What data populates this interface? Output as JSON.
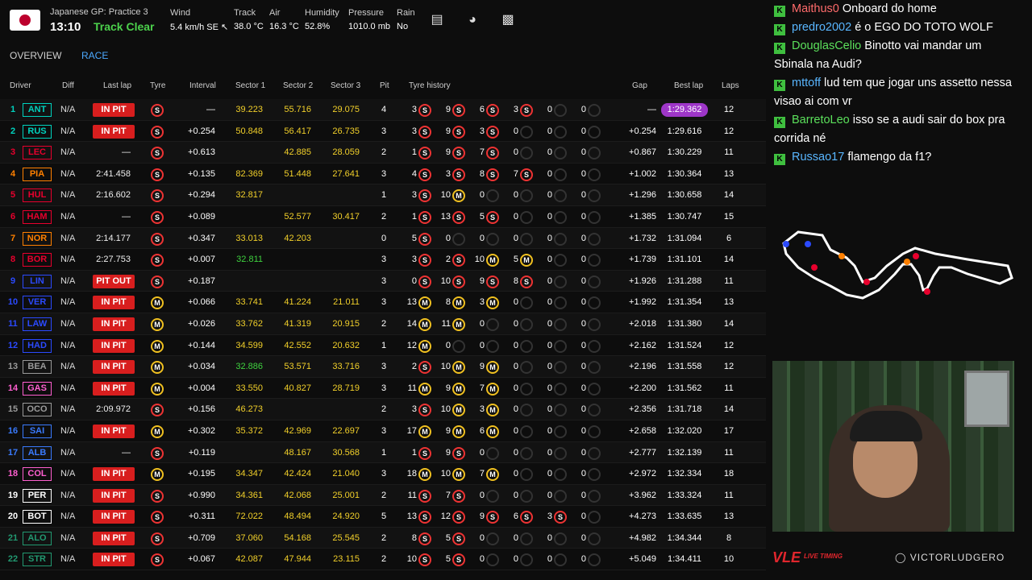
{
  "header": {
    "session": "Japanese GP: Practice 3",
    "time": "13:10",
    "status": "Track Clear",
    "weather": [
      {
        "label": "Wind",
        "value": "5.4 km/h SE ↖"
      },
      {
        "label": "Track",
        "value": "38.0 °C"
      },
      {
        "label": "Air",
        "value": "16.3 °C"
      },
      {
        "label": "Humidity",
        "value": "52.8%"
      },
      {
        "label": "Pressure",
        "value": "1010.0 mb"
      },
      {
        "label": "Rain",
        "value": "No"
      }
    ]
  },
  "tabs": [
    "OVERVIEW",
    "RACE"
  ],
  "columns": [
    "Driver",
    "Diff",
    "Last lap",
    "Tyre",
    "Interval",
    "Sector 1",
    "Sector 2",
    "Sector 3",
    "Pit",
    "Tyre history",
    "Gap",
    "Best lap",
    "Laps"
  ],
  "rows": [
    {
      "pos": "1",
      "abbr": "ANT",
      "color": "#00d2be",
      "diff": "N/A",
      "last": "IN PIT",
      "tyre": "S",
      "interval": "—",
      "s1": "39.223",
      "s1c": "yellow",
      "s2": "55.716",
      "s2c": "yellow",
      "s3": "29.075",
      "s3c": "yellow",
      "pit": "4",
      "hist": [
        [
          "3",
          "S"
        ],
        [
          "9",
          "S"
        ],
        [
          "6",
          "S"
        ],
        [
          "3",
          "S"
        ],
        [
          "0",
          ""
        ],
        [
          "0",
          ""
        ]
      ],
      "gap": "—",
      "best": "1:29.362",
      "purple": true,
      "laps": "12"
    },
    {
      "pos": "2",
      "abbr": "RUS",
      "color": "#00d2be",
      "diff": "N/A",
      "last": "IN PIT",
      "tyre": "S",
      "interval": "+0.254",
      "s1": "50.848",
      "s1c": "yellow",
      "s2": "56.417",
      "s2c": "yellow",
      "s3": "26.735",
      "s3c": "yellow",
      "pit": "3",
      "hist": [
        [
          "3",
          "S"
        ],
        [
          "9",
          "S"
        ],
        [
          "3",
          "S"
        ],
        [
          "0",
          ""
        ],
        [
          "0",
          ""
        ],
        [
          "0",
          ""
        ]
      ],
      "gap": "+0.254",
      "best": "1:29.616",
      "laps": "12"
    },
    {
      "pos": "3",
      "abbr": "LEC",
      "color": "#e8002d",
      "diff": "N/A",
      "last": "—",
      "tyre": "S",
      "interval": "+0.613",
      "s1": "",
      "s2": "42.885",
      "s2c": "yellow",
      "s3": "28.059",
      "s3c": "yellow",
      "pit": "2",
      "hist": [
        [
          "1",
          "S"
        ],
        [
          "9",
          "S"
        ],
        [
          "7",
          "S"
        ],
        [
          "0",
          ""
        ],
        [
          "0",
          ""
        ],
        [
          "0",
          ""
        ]
      ],
      "gap": "+0.867",
      "best": "1:30.229",
      "laps": "11"
    },
    {
      "pos": "4",
      "abbr": "PIA",
      "color": "#ff8000",
      "diff": "N/A",
      "last": "2:41.458",
      "tyre": "S",
      "interval": "+0.135",
      "s1": "82.369",
      "s1c": "yellow",
      "s2": "51.448",
      "s2c": "yellow",
      "s3": "27.641",
      "s3c": "yellow",
      "pit": "3",
      "hist": [
        [
          "4",
          "S"
        ],
        [
          "3",
          "S"
        ],
        [
          "8",
          "S"
        ],
        [
          "7",
          "S"
        ],
        [
          "0",
          ""
        ],
        [
          "0",
          ""
        ]
      ],
      "gap": "+1.002",
      "best": "1:30.364",
      "laps": "13"
    },
    {
      "pos": "5",
      "abbr": "HUL",
      "color": "#e8002d",
      "diff": "N/A",
      "last": "2:16.602",
      "tyre": "S",
      "interval": "+0.294",
      "s1": "32.817",
      "s1c": "yellow",
      "s2": "",
      "s3": "",
      "pit": "1",
      "hist": [
        [
          "3",
          "S"
        ],
        [
          "10",
          "M"
        ],
        [
          "0",
          ""
        ],
        [
          "0",
          ""
        ],
        [
          "0",
          ""
        ],
        [
          "0",
          ""
        ]
      ],
      "gap": "+1.296",
      "best": "1:30.658",
      "laps": "14"
    },
    {
      "pos": "6",
      "abbr": "HAM",
      "color": "#e8002d",
      "diff": "N/A",
      "last": "—",
      "tyre": "S",
      "interval": "+0.089",
      "s1": "",
      "s2": "52.577",
      "s2c": "yellow",
      "s3": "30.417",
      "s3c": "yellow",
      "pit": "2",
      "hist": [
        [
          "1",
          "S"
        ],
        [
          "13",
          "S"
        ],
        [
          "5",
          "S"
        ],
        [
          "0",
          ""
        ],
        [
          "0",
          ""
        ],
        [
          "0",
          ""
        ]
      ],
      "gap": "+1.385",
      "best": "1:30.747",
      "laps": "15"
    },
    {
      "pos": "7",
      "abbr": "NOR",
      "color": "#ff8000",
      "diff": "N/A",
      "last": "2:14.177",
      "tyre": "S",
      "interval": "+0.347",
      "s1": "33.013",
      "s1c": "yellow",
      "s2": "42.203",
      "s2c": "yellow",
      "s3": "",
      "pit": "0",
      "hist": [
        [
          "5",
          "S"
        ],
        [
          "0",
          ""
        ],
        [
          "0",
          ""
        ],
        [
          "0",
          ""
        ],
        [
          "0",
          ""
        ],
        [
          "0",
          ""
        ]
      ],
      "gap": "+1.732",
      "best": "1:31.094",
      "laps": "6"
    },
    {
      "pos": "8",
      "abbr": "BOR",
      "color": "#e8002d",
      "diff": "N/A",
      "last": "2:27.753",
      "tyre": "S",
      "interval": "+0.007",
      "s1": "32.811",
      "s1c": "green",
      "s2": "",
      "s3": "",
      "pit": "3",
      "hist": [
        [
          "3",
          "S"
        ],
        [
          "2",
          "S"
        ],
        [
          "10",
          "M"
        ],
        [
          "5",
          "M"
        ],
        [
          "0",
          ""
        ],
        [
          "0",
          ""
        ]
      ],
      "gap": "+1.739",
      "best": "1:31.101",
      "laps": "14"
    },
    {
      "pos": "9",
      "abbr": "LIN",
      "color": "#2b4aff",
      "diff": "N/A",
      "last": "PIT OUT",
      "tyre": "S",
      "interval": "+0.187",
      "s1": "",
      "s2": "",
      "s3": "",
      "pit": "3",
      "hist": [
        [
          "0",
          "S"
        ],
        [
          "10",
          "S"
        ],
        [
          "9",
          "S"
        ],
        [
          "8",
          "S"
        ],
        [
          "0",
          ""
        ],
        [
          "0",
          ""
        ]
      ],
      "gap": "+1.926",
      "best": "1:31.288",
      "laps": "11"
    },
    {
      "pos": "10",
      "abbr": "VER",
      "color": "#2b4aff",
      "diff": "N/A",
      "last": "IN PIT",
      "tyre": "M",
      "interval": "+0.066",
      "s1": "33.741",
      "s1c": "yellow",
      "s2": "41.224",
      "s2c": "yellow",
      "s3": "21.011",
      "s3c": "yellow",
      "pit": "3",
      "hist": [
        [
          "13",
          "M"
        ],
        [
          "8",
          "M"
        ],
        [
          "3",
          "M"
        ],
        [
          "0",
          ""
        ],
        [
          "0",
          ""
        ],
        [
          "0",
          ""
        ]
      ],
      "gap": "+1.992",
      "best": "1:31.354",
      "laps": "13"
    },
    {
      "pos": "11",
      "abbr": "LAW",
      "color": "#2b4aff",
      "diff": "N/A",
      "last": "IN PIT",
      "tyre": "M",
      "interval": "+0.026",
      "s1": "33.762",
      "s1c": "yellow",
      "s2": "41.319",
      "s2c": "yellow",
      "s3": "20.915",
      "s3c": "yellow",
      "pit": "2",
      "hist": [
        [
          "14",
          "M"
        ],
        [
          "11",
          "M"
        ],
        [
          "0",
          ""
        ],
        [
          "0",
          ""
        ],
        [
          "0",
          ""
        ],
        [
          "0",
          ""
        ]
      ],
      "gap": "+2.018",
      "best": "1:31.380",
      "laps": "14"
    },
    {
      "pos": "12",
      "abbr": "HAD",
      "color": "#2b4aff",
      "diff": "N/A",
      "last": "IN PIT",
      "tyre": "M",
      "interval": "+0.144",
      "s1": "34.599",
      "s1c": "yellow",
      "s2": "42.552",
      "s2c": "yellow",
      "s3": "20.632",
      "s3c": "yellow",
      "pit": "1",
      "hist": [
        [
          "12",
          "M"
        ],
        [
          "0",
          ""
        ],
        [
          "0",
          ""
        ],
        [
          "0",
          ""
        ],
        [
          "0",
          ""
        ],
        [
          "0",
          ""
        ]
      ],
      "gap": "+2.162",
      "best": "1:31.524",
      "laps": "12"
    },
    {
      "pos": "13",
      "abbr": "BEA",
      "color": "#9a9a9a",
      "diff": "N/A",
      "last": "IN PIT",
      "tyre": "M",
      "interval": "+0.034",
      "s1": "32.886",
      "s1c": "green",
      "s2": "53.571",
      "s2c": "yellow",
      "s3": "33.716",
      "s3c": "yellow",
      "pit": "3",
      "hist": [
        [
          "2",
          "S"
        ],
        [
          "10",
          "M"
        ],
        [
          "9",
          "M"
        ],
        [
          "0",
          ""
        ],
        [
          "0",
          ""
        ],
        [
          "0",
          ""
        ]
      ],
      "gap": "+2.196",
      "best": "1:31.558",
      "laps": "12"
    },
    {
      "pos": "14",
      "abbr": "GAS",
      "color": "#ff5fd0",
      "diff": "N/A",
      "last": "IN PIT",
      "tyre": "M",
      "interval": "+0.004",
      "s1": "33.550",
      "s1c": "yellow",
      "s2": "40.827",
      "s2c": "yellow",
      "s3": "28.719",
      "s3c": "yellow",
      "pit": "3",
      "hist": [
        [
          "11",
          "M"
        ],
        [
          "9",
          "M"
        ],
        [
          "7",
          "M"
        ],
        [
          "0",
          ""
        ],
        [
          "0",
          ""
        ],
        [
          "0",
          ""
        ]
      ],
      "gap": "+2.200",
      "best": "1:31.562",
      "laps": "11"
    },
    {
      "pos": "15",
      "abbr": "OCO",
      "color": "#9a9a9a",
      "diff": "N/A",
      "last": "2:09.972",
      "tyre": "S",
      "interval": "+0.156",
      "s1": "46.273",
      "s1c": "yellow",
      "s2": "",
      "s3": "",
      "pit": "2",
      "hist": [
        [
          "3",
          "S"
        ],
        [
          "10",
          "M"
        ],
        [
          "3",
          "M"
        ],
        [
          "0",
          ""
        ],
        [
          "0",
          ""
        ],
        [
          "0",
          ""
        ]
      ],
      "gap": "+2.356",
      "best": "1:31.718",
      "laps": "14"
    },
    {
      "pos": "16",
      "abbr": "SAI",
      "color": "#3a7bff",
      "diff": "N/A",
      "last": "IN PIT",
      "tyre": "M",
      "interval": "+0.302",
      "s1": "35.372",
      "s1c": "yellow",
      "s2": "42.969",
      "s2c": "yellow",
      "s3": "22.697",
      "s3c": "yellow",
      "pit": "3",
      "hist": [
        [
          "17",
          "M"
        ],
        [
          "9",
          "M"
        ],
        [
          "6",
          "M"
        ],
        [
          "0",
          ""
        ],
        [
          "0",
          ""
        ],
        [
          "0",
          ""
        ]
      ],
      "gap": "+2.658",
      "best": "1:32.020",
      "laps": "17"
    },
    {
      "pos": "17",
      "abbr": "ALB",
      "color": "#3a7bff",
      "diff": "N/A",
      "last": "—",
      "tyre": "S",
      "interval": "+0.119",
      "s1": "",
      "s2": "48.167",
      "s2c": "yellow",
      "s3": "30.568",
      "s3c": "yellow",
      "pit": "1",
      "hist": [
        [
          "1",
          "S"
        ],
        [
          "9",
          "S"
        ],
        [
          "0",
          ""
        ],
        [
          "0",
          ""
        ],
        [
          "0",
          ""
        ],
        [
          "0",
          ""
        ]
      ],
      "gap": "+2.777",
      "best": "1:32.139",
      "laps": "11"
    },
    {
      "pos": "18",
      "abbr": "COL",
      "color": "#ff5fd0",
      "diff": "N/A",
      "last": "IN PIT",
      "tyre": "M",
      "interval": "+0.195",
      "s1": "34.347",
      "s1c": "yellow",
      "s2": "42.424",
      "s2c": "yellow",
      "s3": "21.040",
      "s3c": "yellow",
      "pit": "3",
      "hist": [
        [
          "18",
          "M"
        ],
        [
          "10",
          "M"
        ],
        [
          "7",
          "M"
        ],
        [
          "0",
          ""
        ],
        [
          "0",
          ""
        ],
        [
          "0",
          ""
        ]
      ],
      "gap": "+2.972",
      "best": "1:32.334",
      "laps": "18"
    },
    {
      "pos": "19",
      "abbr": "PER",
      "color": "#ffffff",
      "diff": "N/A",
      "last": "IN PIT",
      "tyre": "S",
      "interval": "+0.990",
      "s1": "34.361",
      "s1c": "yellow",
      "s2": "42.068",
      "s2c": "yellow",
      "s3": "25.001",
      "s3c": "yellow",
      "pit": "2",
      "hist": [
        [
          "11",
          "S"
        ],
        [
          "7",
          "S"
        ],
        [
          "0",
          ""
        ],
        [
          "0",
          ""
        ],
        [
          "0",
          ""
        ],
        [
          "0",
          ""
        ]
      ],
      "gap": "+3.962",
      "best": "1:33.324",
      "laps": "11"
    },
    {
      "pos": "20",
      "abbr": "BOT",
      "color": "#ffffff",
      "diff": "N/A",
      "last": "IN PIT",
      "tyre": "S",
      "interval": "+0.311",
      "s1": "72.022",
      "s1c": "yellow",
      "s2": "48.494",
      "s2c": "yellow",
      "s3": "24.920",
      "s3c": "yellow",
      "pit": "5",
      "hist": [
        [
          "13",
          "S"
        ],
        [
          "12",
          "S"
        ],
        [
          "9",
          "S"
        ],
        [
          "6",
          "S"
        ],
        [
          "3",
          "S"
        ],
        [
          "0",
          ""
        ]
      ],
      "gap": "+4.273",
      "best": "1:33.635",
      "laps": "13"
    },
    {
      "pos": "21",
      "abbr": "ALO",
      "color": "#229971",
      "diff": "N/A",
      "last": "IN PIT",
      "tyre": "S",
      "interval": "+0.709",
      "s1": "37.060",
      "s1c": "yellow",
      "s2": "54.168",
      "s2c": "yellow",
      "s3": "25.545",
      "s3c": "yellow",
      "pit": "2",
      "hist": [
        [
          "8",
          "S"
        ],
        [
          "5",
          "S"
        ],
        [
          "0",
          ""
        ],
        [
          "0",
          ""
        ],
        [
          "0",
          ""
        ],
        [
          "0",
          ""
        ]
      ],
      "gap": "+4.982",
      "best": "1:34.344",
      "laps": "8"
    },
    {
      "pos": "22",
      "abbr": "STR",
      "color": "#229971",
      "diff": "N/A",
      "last": "IN PIT",
      "tyre": "S",
      "interval": "+0.067",
      "s1": "42.087",
      "s1c": "yellow",
      "s2": "47.944",
      "s2c": "yellow",
      "s3": "23.115",
      "s3c": "yellow",
      "pit": "2",
      "hist": [
        [
          "10",
          "S"
        ],
        [
          "5",
          "S"
        ],
        [
          "0",
          ""
        ],
        [
          "0",
          ""
        ],
        [
          "0",
          ""
        ],
        [
          "0",
          ""
        ]
      ],
      "gap": "+5.049",
      "best": "1:34.411",
      "laps": "10"
    }
  ],
  "chat": [
    {
      "user": "Maithus0",
      "cls": "red",
      "text": "Onboard do home"
    },
    {
      "user": "predro2002",
      "cls": "",
      "text": "é o EGO DO TOTO WOLF"
    },
    {
      "user": "DouglasCelio",
      "cls": "grn",
      "text": "Binotto vai mandar um Sbinala na Audi?"
    },
    {
      "user": "mttoff",
      "cls": "",
      "text": "lud tem que jogar uns assetto nessa visao ai com vr"
    },
    {
      "user": "BarretoLeo",
      "cls": "grn",
      "text": "isso se a audi sair do box pra corrida né"
    },
    {
      "user": "Russao17",
      "cls": "",
      "text": "flamengo da f1?"
    }
  ],
  "brand": {
    "logo": "VLE",
    "tag": "LIVE TIMING",
    "handle": "VICTORLUDGERO"
  }
}
